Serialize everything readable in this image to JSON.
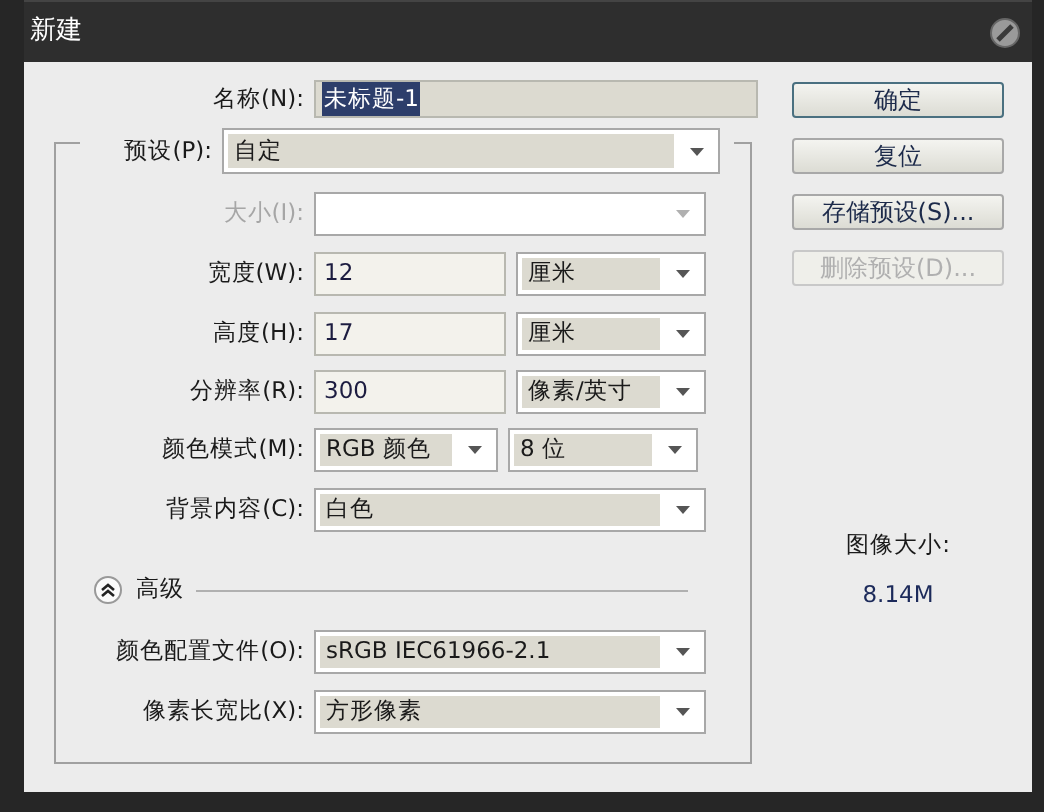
{
  "window": {
    "title": "新建"
  },
  "name_field": {
    "label": "名称(N):",
    "value": "未标题-1",
    "selected": true
  },
  "preset": {
    "label": "预设(P):",
    "value": "自定"
  },
  "rows": [
    {
      "kind": "select",
      "label": "大小(I):",
      "disabled": true
    },
    {
      "kind": "input_unit",
      "label": "宽度(W):",
      "value": "12",
      "unit": "厘米"
    },
    {
      "kind": "input_unit",
      "label": "高度(H):",
      "value": "17",
      "unit": "厘米"
    },
    {
      "kind": "input_unit",
      "label": "分辨率(R):",
      "value": "300",
      "unit": "像素/英寸"
    },
    {
      "kind": "two_selects",
      "label": "颜色模式(M):",
      "value": "RGB 颜色",
      "unit": "8 位"
    },
    {
      "kind": "select",
      "label": "背景内容(C):",
      "value": "白色",
      "disabled": false
    }
  ],
  "advanced": {
    "label": "高级",
    "expanded": true,
    "rows": [
      {
        "kind": "select",
        "label": "颜色配置文件(O):",
        "value": "sRGB IEC61966-2.1",
        "disabled": false
      },
      {
        "kind": "select",
        "label": "像素长宽比(X):",
        "value": "方形像素",
        "disabled": false
      }
    ]
  },
  "buttons": [
    {
      "label": "确定",
      "default": true,
      "disabled": false
    },
    {
      "label": "复位",
      "default": false,
      "disabled": false
    },
    {
      "label": "存储预设(S)...",
      "default": false,
      "disabled": false
    },
    {
      "label": "删除预设(D)...",
      "default": false,
      "disabled": true
    }
  ],
  "image_size": {
    "label": "图像大小:",
    "value": "8.14M"
  }
}
